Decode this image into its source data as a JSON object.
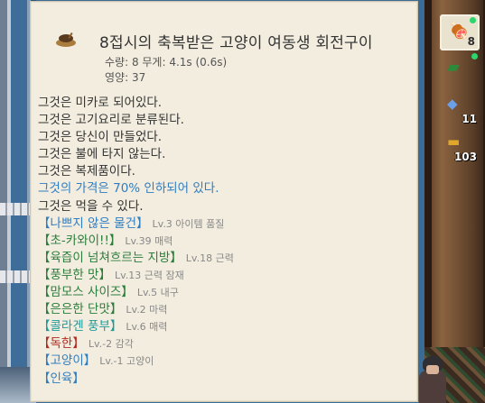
{
  "item": {
    "title": "8접시의 축복받은 고양이 여동생 회전구이",
    "icon": "grilled-fish-plate-icon",
    "meta_line1": "수량: 8 무게: 4.1s (0.6s)",
    "meta_line2": "영양: 37"
  },
  "description_lines": [
    "그것은 미카로 되어있다.",
    "그것은 고기요리로 분류된다.",
    "그것은 당신이 만들었다.",
    "그것은 불에 타지 않는다.",
    "그것은 복제품이다.",
    "그것의 가격은 70% 인하되어 있다.",
    "그것은 먹을 수 있다."
  ],
  "enchantments": [
    {
      "name": "【나쁘지 않은 물건】",
      "detail": "Lv.3 아이템 품질",
      "color": "#2f7dc0"
    },
    {
      "name": "【초-카와이!!】",
      "detail": "Lv.39 매력",
      "color": "#2a7d3a"
    },
    {
      "name": "【육즙이 넘쳐흐르는 지방】",
      "detail": "Lv.18 근력",
      "color": "#2a7d3a"
    },
    {
      "name": "【풍부한 맛】",
      "detail": "Lv.13 근력 잠재",
      "color": "#2a7d3a"
    },
    {
      "name": "【맘모스 사이즈】",
      "detail": "Lv.5 내구",
      "color": "#2a7d3a"
    },
    {
      "name": "【은은한 단맛】",
      "detail": "Lv.2 마력",
      "color": "#2a7d3a"
    },
    {
      "name": "【콜라겐 풍부】",
      "detail": "Lv.6 매력",
      "color": "#1e9a9a"
    },
    {
      "name": "【독한】",
      "detail": "Lv.-2 감각",
      "color": "#b22a1e"
    },
    {
      "name": "【고양이】",
      "detail": "Lv.-1 고양이",
      "color": "#2f7dc0"
    },
    {
      "name": "【인육】",
      "detail": "",
      "color": "#2f7dc0"
    }
  ],
  "side_slots": [
    {
      "icon": "grilled-fish-icon",
      "count": "8",
      "selected": true
    },
    {
      "icon": "green-scroll-icon",
      "count": "",
      "selected": false
    },
    {
      "icon": "blue-ticket-icon",
      "count": "11",
      "selected": false
    },
    {
      "icon": "gold-bar-icon",
      "count": "103",
      "selected": false
    }
  ]
}
